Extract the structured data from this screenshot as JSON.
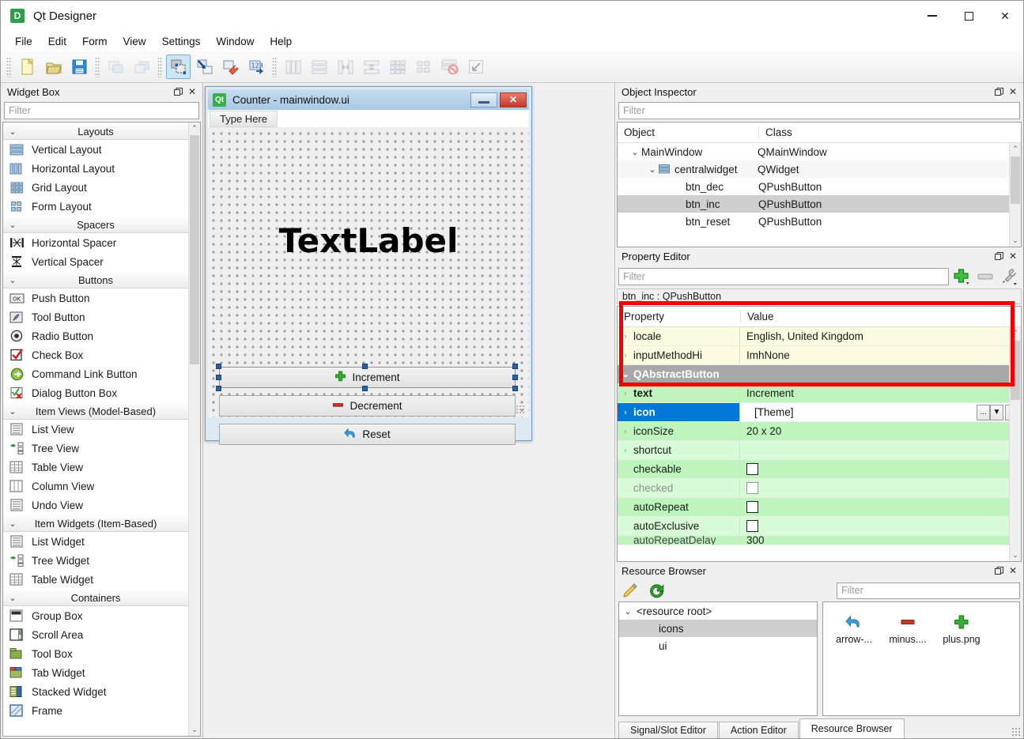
{
  "window": {
    "title": "Qt Designer",
    "icon": "designer-icon",
    "minimize": "minimize-icon",
    "maximize": "maximize-icon",
    "close": "close-icon"
  },
  "menubar": {
    "items": [
      "File",
      "Edit",
      "Form",
      "View",
      "Settings",
      "Window",
      "Help"
    ]
  },
  "toolbar": {
    "groups": [
      {
        "buttons": [
          {
            "name": "new-form-button",
            "icon": "new-file-icon",
            "active": false,
            "disabled": false
          },
          {
            "name": "open-form-button",
            "icon": "open-folder-icon",
            "active": false,
            "disabled": false
          },
          {
            "name": "save-form-button",
            "icon": "save-disk-icon",
            "active": false,
            "disabled": false
          }
        ]
      },
      {
        "buttons": [
          {
            "name": "undo-button",
            "icon": "undo-stack-icon",
            "active": false,
            "disabled": true
          },
          {
            "name": "redo-button",
            "icon": "redo-stack-icon",
            "active": false,
            "disabled": true
          }
        ]
      },
      {
        "buttons": [
          {
            "name": "edit-widgets-button",
            "icon": "edit-widgets-icon",
            "active": true,
            "disabled": false
          },
          {
            "name": "edit-signals-slots-button",
            "icon": "signals-slots-icon",
            "active": false,
            "disabled": false
          },
          {
            "name": "edit-buddies-button",
            "icon": "buddies-icon",
            "active": false,
            "disabled": false
          },
          {
            "name": "edit-tab-order-button",
            "icon": "tab-order-icon",
            "active": false,
            "disabled": false
          }
        ]
      },
      {
        "buttons": [
          {
            "name": "layout-horizontally-button",
            "icon": "layout-horizontal-icon",
            "active": false,
            "disabled": true
          },
          {
            "name": "layout-vertically-button",
            "icon": "layout-vertical-icon",
            "active": false,
            "disabled": true
          },
          {
            "name": "layout-splitter-horizontal-button",
            "icon": "splitter-horizontal-icon",
            "active": false,
            "disabled": true
          },
          {
            "name": "layout-splitter-vertical-button",
            "icon": "splitter-vertical-icon",
            "active": false,
            "disabled": true
          },
          {
            "name": "layout-grid-button",
            "icon": "layout-grid-icon",
            "active": false,
            "disabled": true
          },
          {
            "name": "layout-form-button",
            "icon": "layout-form-icon",
            "active": false,
            "disabled": true
          },
          {
            "name": "break-layout-button",
            "icon": "break-layout-icon",
            "active": false,
            "disabled": true
          },
          {
            "name": "adjust-size-button",
            "icon": "adjust-size-icon",
            "active": false,
            "disabled": true
          }
        ]
      }
    ]
  },
  "widget_box": {
    "title": "Widget Box",
    "float_btn": "float-icon",
    "close_btn": "close-icon",
    "filter_placeholder": "Filter",
    "categories": [
      {
        "label": "Layouts",
        "expanded": true,
        "items": [
          {
            "label": "Vertical Layout",
            "icon": "vertical-layout-icon"
          },
          {
            "label": "Horizontal Layout",
            "icon": "horizontal-layout-icon"
          },
          {
            "label": "Grid Layout",
            "icon": "grid-layout-icon"
          },
          {
            "label": "Form Layout",
            "icon": "form-layout-icon"
          }
        ]
      },
      {
        "label": "Spacers",
        "expanded": true,
        "items": [
          {
            "label": "Horizontal Spacer",
            "icon": "horizontal-spacer-icon"
          },
          {
            "label": "Vertical Spacer",
            "icon": "vertical-spacer-icon"
          }
        ]
      },
      {
        "label": "Buttons",
        "expanded": true,
        "items": [
          {
            "label": "Push Button",
            "icon": "push-button-icon"
          },
          {
            "label": "Tool Button",
            "icon": "tool-button-icon"
          },
          {
            "label": "Radio Button",
            "icon": "radio-button-icon"
          },
          {
            "label": "Check Box",
            "icon": "check-box-icon"
          },
          {
            "label": "Command Link Button",
            "icon": "command-link-icon"
          },
          {
            "label": "Dialog Button Box",
            "icon": "dialog-button-box-icon"
          }
        ]
      },
      {
        "label": "Item Views (Model-Based)",
        "expanded": true,
        "items": [
          {
            "label": "List View",
            "icon": "list-view-icon"
          },
          {
            "label": "Tree View",
            "icon": "tree-view-icon"
          },
          {
            "label": "Table View",
            "icon": "table-view-icon"
          },
          {
            "label": "Column View",
            "icon": "column-view-icon"
          },
          {
            "label": "Undo View",
            "icon": "undo-view-icon"
          }
        ]
      },
      {
        "label": "Item Widgets (Item-Based)",
        "expanded": true,
        "items": [
          {
            "label": "List Widget",
            "icon": "list-widget-icon"
          },
          {
            "label": "Tree Widget",
            "icon": "tree-widget-icon"
          },
          {
            "label": "Table Widget",
            "icon": "table-widget-icon"
          }
        ]
      },
      {
        "label": "Containers",
        "expanded": true,
        "items": [
          {
            "label": "Group Box",
            "icon": "group-box-icon"
          },
          {
            "label": "Scroll Area",
            "icon": "scroll-area-icon"
          },
          {
            "label": "Tool Box",
            "icon": "tool-box-icon"
          },
          {
            "label": "Tab Widget",
            "icon": "tab-widget-icon"
          },
          {
            "label": "Stacked Widget",
            "icon": "stacked-widget-icon"
          },
          {
            "label": "Frame",
            "icon": "frame-icon"
          }
        ]
      }
    ]
  },
  "form_window": {
    "title": "Counter - mainwindow.ui",
    "icon": "qt-icon",
    "minimize": "minimize-icon",
    "close": "close-icon",
    "menu_placeholder": "Type Here",
    "label_text": "TextLabel",
    "buttons": [
      {
        "label": "Increment",
        "icon": "plus-icon",
        "selected": true
      },
      {
        "label": "Decrement",
        "icon": "minus-icon",
        "selected": false
      },
      {
        "label": "Reset",
        "icon": "arrow-undo-icon",
        "selected": false
      }
    ]
  },
  "object_inspector": {
    "title": "Object Inspector",
    "float_btn": "float-icon",
    "close_btn": "close-icon",
    "filter_placeholder": "Filter",
    "columns": [
      "Object",
      "Class"
    ],
    "rows": [
      {
        "object": "MainWindow",
        "class": "QMainWindow",
        "depth": 0,
        "chevron": "chevron-down-icon",
        "icon": "",
        "selected": false
      },
      {
        "object": "centralwidget",
        "class": "QWidget",
        "depth": 1,
        "chevron": "chevron-down-icon",
        "icon": "vertical-layout-icon",
        "selected": false
      },
      {
        "object": "btn_dec",
        "class": "QPushButton",
        "depth": 2,
        "chevron": "",
        "icon": "",
        "selected": false
      },
      {
        "object": "btn_inc",
        "class": "QPushButton",
        "depth": 2,
        "chevron": "",
        "icon": "",
        "selected": true
      },
      {
        "object": "btn_reset",
        "class": "QPushButton",
        "depth": 2,
        "chevron": "",
        "icon": "",
        "selected": false
      }
    ]
  },
  "property_editor": {
    "title": "Property Editor",
    "float_btn": "float-icon",
    "close_btn": "close-icon",
    "filter_placeholder": "Filter",
    "add_button": "add-property-icon",
    "remove_button": "remove-property-icon",
    "configure_button": "configure-icon",
    "object_line": "btn_inc : QPushButton",
    "columns": [
      "Property",
      "Value"
    ],
    "rows": [
      {
        "property": "locale",
        "value": "English, United Kingdom",
        "style": "yellow",
        "chevron": "chevron-right-icon",
        "kind": "text"
      },
      {
        "property": "inputMethodHi",
        "value": "ImhNone",
        "style": "yellow",
        "chevron": "chevron-right-icon",
        "kind": "text"
      },
      {
        "property": "QAbstractButton",
        "value": "",
        "style": "grouphdr",
        "chevron": "chevron-down-icon",
        "kind": "group"
      },
      {
        "property": "text",
        "value": "Increment",
        "style": "green",
        "chevron": "chevron-right-icon",
        "kind": "text",
        "bold": true
      },
      {
        "property": "icon",
        "value": "[Theme]",
        "style": "green",
        "chevron": "chevron-right-icon",
        "kind": "iconedit",
        "selected": true
      },
      {
        "property": "iconSize",
        "value": "20 x 20",
        "style": "green",
        "chevron": "chevron-right-icon",
        "kind": "text"
      },
      {
        "property": "shortcut",
        "value": "",
        "style": "green-lt",
        "chevron": "chevron-right-icon",
        "kind": "text"
      },
      {
        "property": "checkable",
        "value": "",
        "style": "green",
        "chevron": "",
        "kind": "checkbox",
        "checked": false
      },
      {
        "property": "checked",
        "value": "",
        "style": "green-lt",
        "chevron": "",
        "kind": "checkbox",
        "checked": false,
        "disabled": true
      },
      {
        "property": "autoRepeat",
        "value": "",
        "style": "green",
        "chevron": "",
        "kind": "checkbox",
        "checked": false
      },
      {
        "property": "autoExclusive",
        "value": "",
        "style": "green-lt",
        "chevron": "",
        "kind": "checkbox",
        "checked": false
      },
      {
        "property": "autoRepeatDelay",
        "value": "300",
        "style": "green",
        "chevron": "",
        "kind": "text"
      }
    ],
    "icon_editor": {
      "browse_label": "...",
      "dropdown_icon": "chevron-down-icon",
      "reset_icon": "reset-arrow-icon"
    }
  },
  "resource_browser": {
    "title": "Resource Browser",
    "float_btn": "float-icon",
    "close_btn": "close-icon",
    "edit_button": "pencil-icon",
    "reload_button": "reload-icon",
    "filter_placeholder": "Filter",
    "tree": [
      {
        "label": "<resource root>",
        "depth": 0,
        "chevron": "chevron-down-icon",
        "selected": false
      },
      {
        "label": "icons",
        "depth": 1,
        "chevron": "",
        "selected": true
      },
      {
        "label": "ui",
        "depth": 1,
        "chevron": "",
        "selected": false
      }
    ],
    "resources": [
      {
        "label": "arrow-...",
        "icon": "arrow-undo-icon"
      },
      {
        "label": "minus....",
        "icon": "minus-icon"
      },
      {
        "label": "plus.png",
        "icon": "plus-icon"
      }
    ],
    "tabs": [
      {
        "label": "Signal/Slot Editor",
        "active": false
      },
      {
        "label": "Action Editor",
        "active": false
      },
      {
        "label": "Resource Browser",
        "active": true
      }
    ]
  },
  "colors": {
    "accent": "#0078d7",
    "highlight_box": "#f20000",
    "property_green": "#bdf5bd",
    "property_yellow": "#fcfbdf",
    "plus_icon": "#2eb82e",
    "minus_icon": "#c0392b",
    "arrow_icon": "#3f9fe0"
  }
}
